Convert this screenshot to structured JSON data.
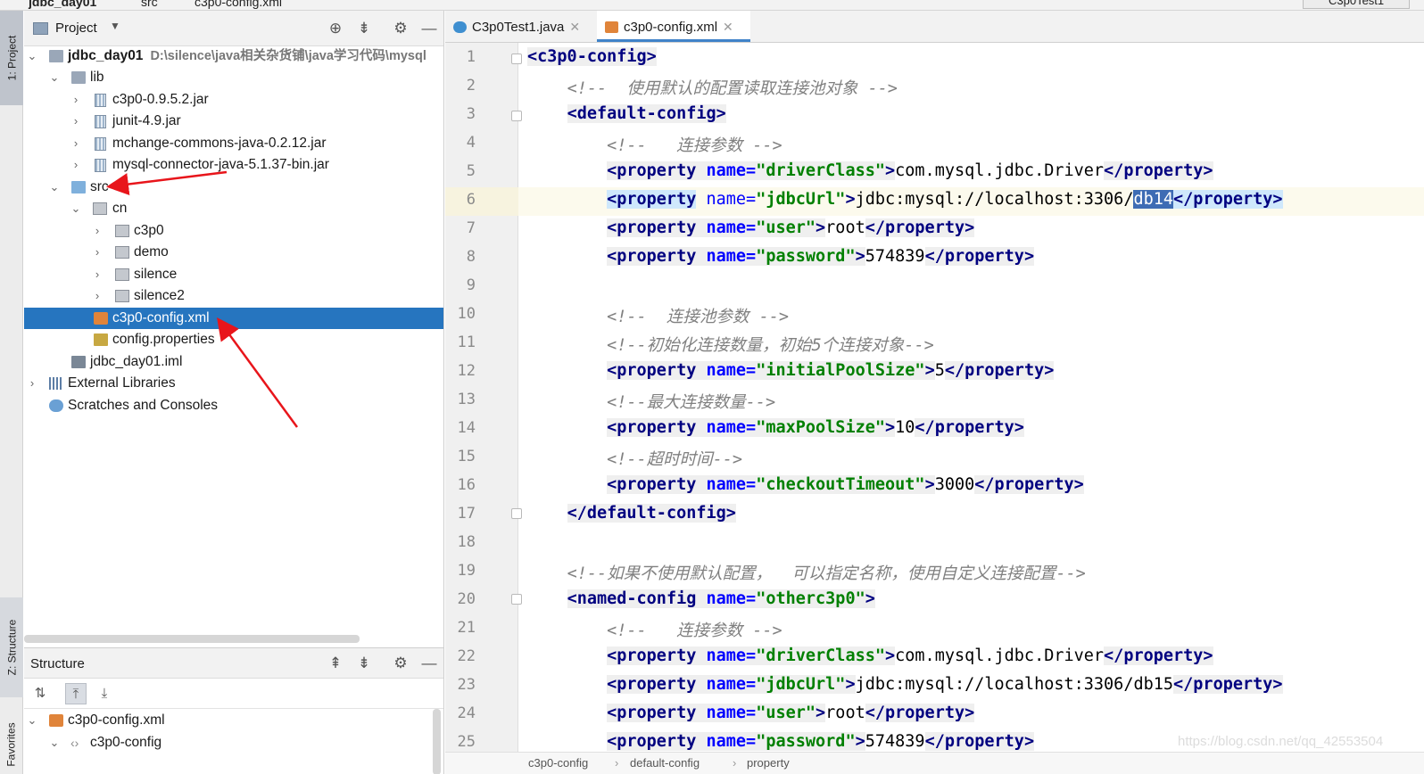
{
  "top_bar": {
    "crumbs": [
      "jdbc_day01",
      "src",
      "c3p0-config.xml"
    ],
    "run_config": "C3p0Test1"
  },
  "left_strip": {
    "project_tab": "1: Project",
    "structure_tab": "Z: Structure",
    "favorites_tab": "Favorites"
  },
  "project_panel": {
    "title": "Project",
    "tree": [
      {
        "label": "jdbc_day01",
        "path": "D:\\silence\\java相关杂货铺\\java学习代码\\mysql",
        "icon": "module-folder-icon",
        "bold": true
      },
      {
        "label": "lib",
        "icon": "folder-icon"
      },
      {
        "label": "c3p0-0.9.5.2.jar",
        "icon": "jar-icon"
      },
      {
        "label": "junit-4.9.jar",
        "icon": "jar-icon"
      },
      {
        "label": "mchange-commons-java-0.2.12.jar",
        "icon": "jar-icon"
      },
      {
        "label": "mysql-connector-java-5.1.37-bin.jar",
        "icon": "jar-icon"
      },
      {
        "label": "src",
        "icon": "source-folder-icon"
      },
      {
        "label": "cn",
        "icon": "package-icon"
      },
      {
        "label": "c3p0",
        "icon": "package-icon"
      },
      {
        "label": "demo",
        "icon": "package-icon"
      },
      {
        "label": "silence",
        "icon": "package-icon"
      },
      {
        "label": "silence2",
        "icon": "package-icon"
      },
      {
        "label": "c3p0-config.xml",
        "icon": "xml-file-icon",
        "selected": true
      },
      {
        "label": "config.properties",
        "icon": "properties-file-icon"
      },
      {
        "label": "jdbc_day01.iml",
        "icon": "iml-file-icon"
      },
      {
        "label": "External Libraries",
        "icon": "libraries-icon"
      },
      {
        "label": "Scratches and Consoles",
        "icon": "scratches-icon"
      }
    ]
  },
  "structure_panel": {
    "title": "Structure",
    "tree": [
      {
        "label": "c3p0-config.xml",
        "icon": "xml-file-icon"
      },
      {
        "label": "c3p0-config",
        "icon": "xml-tag-icon"
      }
    ]
  },
  "editor_tabs": [
    {
      "label": "C3p0Test1.java",
      "icon": "java-class-icon",
      "active": false
    },
    {
      "label": "c3p0-config.xml",
      "icon": "xml-file-icon",
      "active": true
    }
  ],
  "editor": {
    "line_numbers": [
      "1",
      "2",
      "3",
      "4",
      "5",
      "6",
      "7",
      "8",
      "9",
      "10",
      "11",
      "12",
      "13",
      "14",
      "15",
      "16",
      "17",
      "18",
      "19",
      "20",
      "21",
      "22",
      "23",
      "24",
      "25"
    ],
    "current_line": 6,
    "selected_text": "db14"
  },
  "editor_breadcrumb": [
    "c3p0-config",
    "default-config",
    "property"
  ],
  "watermark": "https://blog.csdn.net/qq_42553504"
}
